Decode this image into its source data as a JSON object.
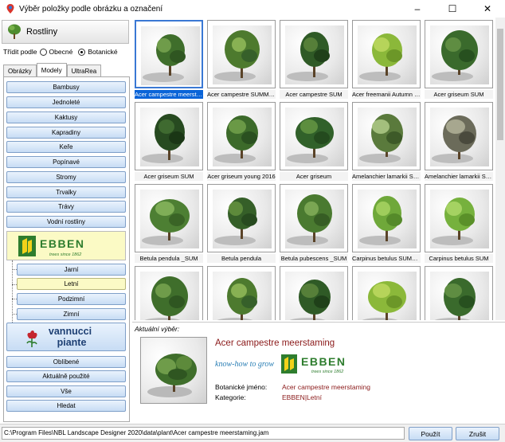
{
  "window": {
    "title": "Výběr položky podle obrázku a označení",
    "controls": {
      "minimize": "–",
      "maximize": "☐",
      "close": "✕"
    }
  },
  "sidebar": {
    "category_title": "Rostliny",
    "sort": {
      "label": "Třídit podle",
      "options": [
        "Obecné",
        "Botanické"
      ],
      "selected": "Botanické"
    },
    "tabs": [
      "Obrázky",
      "Modely",
      "UltraRea"
    ],
    "active_tab": "Modely",
    "categories": [
      "Bambusy",
      "Jednoleté",
      "Kaktusy",
      "Kapradiny",
      "Keře",
      "Popínavé",
      "Stromy",
      "Trvalky",
      "Trávy",
      "Vodní rostliny"
    ],
    "ebben_logo": {
      "name": "EBBEN",
      "tagline": "trees since 1862"
    },
    "seasons": [
      "Jarní",
      "Letní",
      "Podzimní",
      "Zimní"
    ],
    "selected_season": "Letní",
    "vannucci_logo": {
      "line1": "vannucci",
      "line2": "piante"
    },
    "bottom_buttons": [
      "Oblíbené",
      "Aktuálně použité",
      "Vše",
      "Hledat"
    ]
  },
  "grid": {
    "tiles": [
      {
        "label": "Acer campestre meerstaming",
        "selected": true
      },
      {
        "label": "Acer campestre SUMMER",
        "selected": false
      },
      {
        "label": "Acer campestre SUM",
        "selected": false
      },
      {
        "label": "Acer freemanii Autumn Blaze",
        "selected": false
      },
      {
        "label": "Acer griseum SUM",
        "selected": false
      },
      {
        "label": "Acer griseum SUM",
        "selected": false
      },
      {
        "label": "Acer griseum young 2016",
        "selected": false
      },
      {
        "label": "Acer griseum",
        "selected": false
      },
      {
        "label": "Amelanchier lamarkii SUM",
        "selected": false
      },
      {
        "label": "Amelanchier lamarkii SUM",
        "selected": false
      },
      {
        "label": "Betula pendula _SUM",
        "selected": false
      },
      {
        "label": "Betula pendula",
        "selected": false
      },
      {
        "label": "Betula pubescens _SUM",
        "selected": false
      },
      {
        "label": "Carpinus betulus SUMMER",
        "selected": false
      },
      {
        "label": "Carpinus betulus SUM",
        "selected": false
      },
      {
        "label": "",
        "selected": false
      },
      {
        "label": "",
        "selected": false
      },
      {
        "label": "",
        "selected": false
      },
      {
        "label": "",
        "selected": false
      },
      {
        "label": "",
        "selected": false
      }
    ]
  },
  "selection": {
    "caption": "Aktuální výběr:",
    "name": "Acer campestre meerstaming",
    "logo_slogan": "know-how to grow",
    "logo_name": "EBBEN",
    "logo_tagline": "trees since 1862",
    "botanical_label": "Botanické jméno:",
    "botanical_value": "Acer campestre meerstaming",
    "category_label": "Kategorie:",
    "category_value": "EBBEN|Letní"
  },
  "status": {
    "path": "C:\\Program Files\\NBL Landscape Designer 2020\\data\\plant\\Acer campestre meerstaming.jam",
    "use_button": "Použít",
    "cancel_button": "Zrušit"
  },
  "colors": {
    "accent": "#0a64d8",
    "selected_label": "#8b1a1a",
    "button_top": "#eaf3fd",
    "button_bottom": "#c7dcf4",
    "highlight": "#fbfac5",
    "ebben_green": "#2e7d2e",
    "ebben_yellow": "#f3d21a"
  },
  "icons": {
    "app": "map-pin-icon",
    "category": "plant-icon"
  }
}
